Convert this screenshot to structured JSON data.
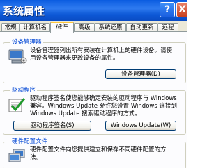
{
  "window": {
    "title": "系统属性"
  },
  "titlebar": {
    "help_glyph": "?",
    "close_glyph": "X"
  },
  "tabs": [
    {
      "label": "常规"
    },
    {
      "label": "计算机名"
    },
    {
      "label": "硬件"
    },
    {
      "label": "高级"
    },
    {
      "label": "系统还原"
    },
    {
      "label": "自动更新"
    },
    {
      "label": "远程"
    }
  ],
  "device_manager": {
    "title": "设备管理器",
    "description_line1": "设备管理器列出所有安装在计算机上的硬件设备。请使",
    "description_line2": "用设备管理器来更改设备的属性。",
    "button_label": "设备管理器(D)"
  },
  "drivers": {
    "title": "驱动程序",
    "description_line1": "驱动程序签名使您能够确定安装的驱动程序与 Windows",
    "description_line2": "兼容。Windows Update 允许您设置 Windows 连接到",
    "description_line3": "Windows Update 搜索驱动程序的方式。",
    "signing_button_label": "驱动程序签名(S)",
    "update_button_label": "Windows Update(W)"
  },
  "hardware_profiles": {
    "title": "硬件配置文件",
    "description_line1": "硬件配置文件向您提供建立和保存不同硬件配置的方",
    "description_line2": "法。"
  }
}
